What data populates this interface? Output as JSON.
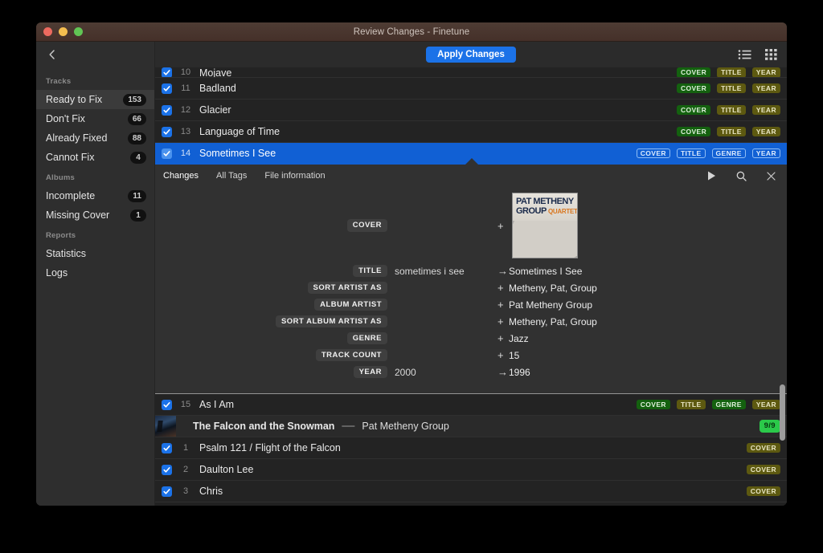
{
  "window": {
    "title": "Review Changes - Finetune",
    "traffic_lights": [
      "close-button",
      "minimize-button",
      "zoom-button"
    ]
  },
  "sidebar": {
    "back_icon": "chevron-left-icon",
    "sections": [
      {
        "heading": "Tracks",
        "items": [
          {
            "label": "Ready to Fix",
            "count": "153",
            "active": true
          },
          {
            "label": "Don't Fix",
            "count": "66",
            "active": false
          },
          {
            "label": "Already Fixed",
            "count": "88",
            "active": false
          },
          {
            "label": "Cannot Fix",
            "count": "4",
            "active": false
          }
        ]
      },
      {
        "heading": "Albums",
        "items": [
          {
            "label": "Incomplete",
            "count": "11",
            "active": false
          },
          {
            "label": "Missing Cover",
            "count": "1",
            "active": false
          }
        ]
      },
      {
        "heading": "Reports",
        "items": [
          {
            "label": "Statistics",
            "count": "",
            "active": false
          },
          {
            "label": "Logs",
            "count": "",
            "active": false
          }
        ]
      }
    ]
  },
  "toolbar": {
    "apply_label": "Apply Changes",
    "list_view_icon": "list-view-icon",
    "grid_view_icon": "grid-view-icon"
  },
  "tracks_top": [
    {
      "num": "10",
      "title": "Mojave",
      "selected": false,
      "badges": [
        {
          "text": "COVER",
          "kind": "green"
        },
        {
          "text": "TITLE",
          "kind": "olive"
        },
        {
          "text": "YEAR",
          "kind": "olive"
        }
      ]
    },
    {
      "num": "11",
      "title": "Badland",
      "selected": false,
      "badges": [
        {
          "text": "COVER",
          "kind": "green"
        },
        {
          "text": "TITLE",
          "kind": "olive"
        },
        {
          "text": "YEAR",
          "kind": "olive"
        }
      ]
    },
    {
      "num": "12",
      "title": "Glacier",
      "selected": false,
      "badges": [
        {
          "text": "COVER",
          "kind": "green"
        },
        {
          "text": "TITLE",
          "kind": "olive"
        },
        {
          "text": "YEAR",
          "kind": "olive"
        }
      ]
    },
    {
      "num": "13",
      "title": "Language of Time",
      "selected": false,
      "badges": [
        {
          "text": "COVER",
          "kind": "green"
        },
        {
          "text": "TITLE",
          "kind": "olive"
        },
        {
          "text": "YEAR",
          "kind": "olive"
        }
      ]
    },
    {
      "num": "14",
      "title": "Sometimes I See",
      "selected": true,
      "badges": [
        {
          "text": "COVER",
          "kind": "sel"
        },
        {
          "text": "TITLE",
          "kind": "sel"
        },
        {
          "text": "GENRE",
          "kind": "sel"
        },
        {
          "text": "YEAR",
          "kind": "sel"
        }
      ]
    }
  ],
  "detail": {
    "tabs": [
      {
        "label": "Changes",
        "active": true
      },
      {
        "label": "All Tags",
        "active": false
      },
      {
        "label": "File information",
        "active": false
      }
    ],
    "play_icon": "play-icon",
    "search_icon": "search-icon",
    "close_icon": "close-icon",
    "fields": [
      {
        "tag": "COVER",
        "old": "",
        "mark": "+",
        "new": "",
        "is_cover": true
      },
      {
        "tag": "TITLE",
        "old": "sometimes i see",
        "mark": "→",
        "new": "Sometimes I See"
      },
      {
        "tag": "SORT ARTIST AS",
        "old": "",
        "mark": "+",
        "new": "Metheny, Pat, Group"
      },
      {
        "tag": "ALBUM ARTIST",
        "old": "",
        "mark": "+",
        "new": "Pat Metheny Group"
      },
      {
        "tag": "SORT ALBUM ARTIST AS",
        "old": "",
        "mark": "+",
        "new": "Metheny, Pat, Group"
      },
      {
        "tag": "GENRE",
        "old": "",
        "mark": "+",
        "new": "Jazz"
      },
      {
        "tag": "TRACK COUNT",
        "old": "",
        "mark": "+",
        "new": "15"
      },
      {
        "tag": "YEAR",
        "old": "2000",
        "mark": "→",
        "new": "1996"
      }
    ],
    "cover_art": {
      "line1": "PAT METHENY",
      "line2": "GROUP",
      "line3": "QUARTET"
    }
  },
  "tracks_bottom": [
    {
      "num": "15",
      "title": "As I Am",
      "selected": false,
      "badges": [
        {
          "text": "COVER",
          "kind": "green"
        },
        {
          "text": "TITLE",
          "kind": "olive"
        },
        {
          "text": "GENRE",
          "kind": "green"
        },
        {
          "text": "YEAR",
          "kind": "olive"
        }
      ]
    }
  ],
  "album_group": {
    "name": "The Falcon and the Snowman",
    "separator": "—",
    "artist": "Pat Metheny Group",
    "progress_badge": "9/9",
    "thumbnail": "album-thumbnail"
  },
  "tracks_album": [
    {
      "num": "1",
      "title": "Psalm 121 / Flight of the Falcon",
      "badges": [
        {
          "text": "COVER",
          "kind": "olive"
        }
      ]
    },
    {
      "num": "2",
      "title": "Daulton Lee",
      "badges": [
        {
          "text": "COVER",
          "kind": "olive"
        }
      ]
    },
    {
      "num": "3",
      "title": "Chris",
      "badges": [
        {
          "text": "COVER",
          "kind": "olive"
        }
      ]
    }
  ],
  "colors": {
    "accent_blue": "#1b72e8",
    "selection_blue": "#1160d4",
    "badge_green": "#14610f",
    "badge_olive": "#5d5910",
    "badge_bright_green": "#2bc94a",
    "titlebar": "#4e3c34"
  }
}
